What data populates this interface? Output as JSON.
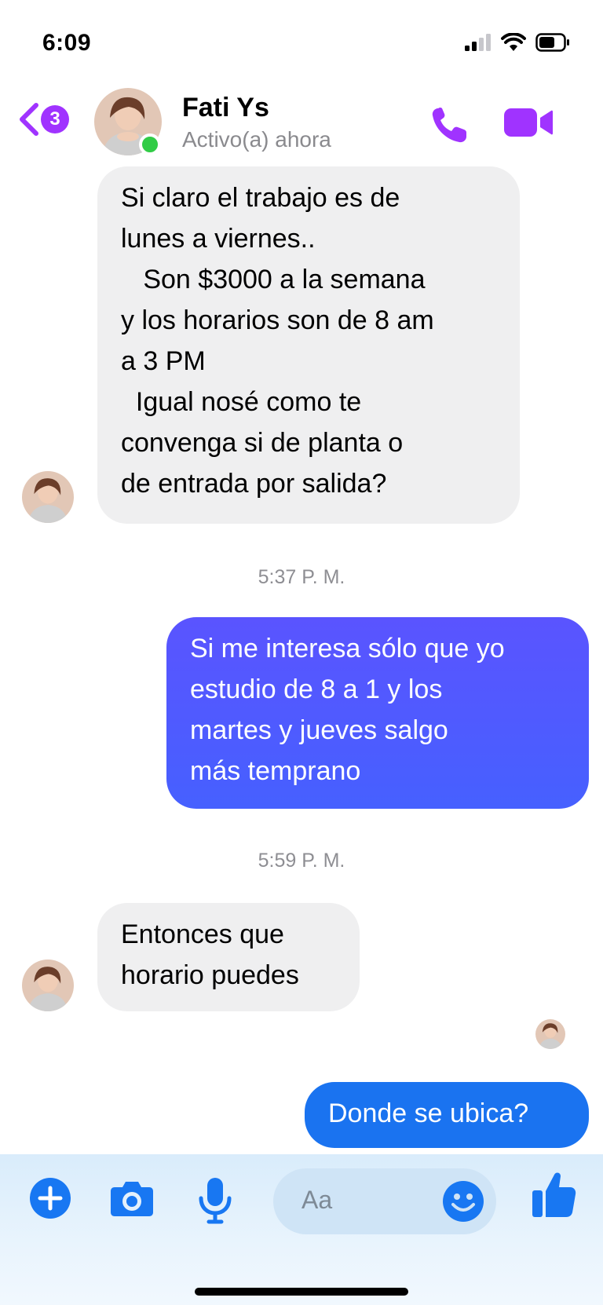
{
  "status_bar": {
    "time": "6:09"
  },
  "header": {
    "unread_count": "3",
    "contact_name": "Fati Ys",
    "contact_status": "Activo(a) ahora"
  },
  "messages": [
    {
      "direction": "incoming",
      "text": "Si claro el trabajo es de\nlunes a viernes..\n   Son $3000 a la semana\ny los horarios son de 8 am\na 3 PM\n  Igual nosé como te\nconvenga si de planta o\nde entrada por salida?"
    },
    {
      "type": "timestamp",
      "text": "5:37 P. M."
    },
    {
      "direction": "outgoing",
      "text": "Si me interesa sólo que yo\nestudio de 8 a 1 y los\nmartes y jueves salgo\nmás temprano"
    },
    {
      "type": "timestamp",
      "text": "5:59 P. M."
    },
    {
      "direction": "incoming",
      "text": "Entonces que\nhorario puedes"
    },
    {
      "direction": "outgoing",
      "text": "Donde se ubica?"
    }
  ],
  "composer": {
    "placeholder": "Aa"
  },
  "colors": {
    "accent_purple": "#a033ff",
    "outgoing_bubble_1": "#4b5cff",
    "outgoing_bubble_2": "#1a73f0",
    "messenger_blue": "#1877f2",
    "online_green": "#31cc46",
    "incoming_bubble": "#efeff0"
  }
}
